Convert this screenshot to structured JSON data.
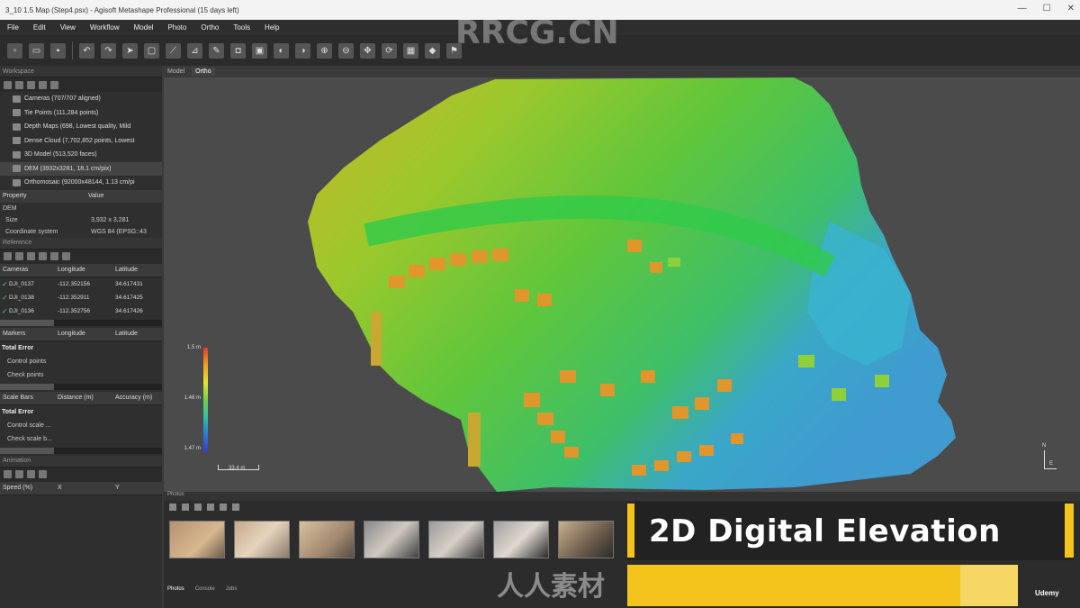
{
  "window": {
    "title": "3_10 1.5  Map (Step4.psx) - Agisoft Metashape Professional (15 days left)",
    "controls": [
      "—",
      "☐",
      "✕"
    ]
  },
  "menu": [
    "File",
    "Edit",
    "View",
    "Workflow",
    "Model",
    "Photo",
    "Ortho",
    "Tools",
    "Help"
  ],
  "workspace": {
    "header": "Workspace",
    "items": [
      "Cameras (707/707 aligned)",
      "Tie Points (111,284 points)",
      "Depth Maps (698, Lowest quality, Mild",
      "Dense Cloud (7,702,852 points, Lowest",
      "3D Model (513,520 faces)",
      "DEM (3932x3281, 18.1 cm/pix)",
      "Orthomosaic (92000x48144, 1.13 cm/pi"
    ]
  },
  "properties": {
    "columns": [
      "Property",
      "Value"
    ],
    "section": "DEM",
    "rows": [
      {
        "key": "Size",
        "value": "3,932 x 3,281"
      },
      {
        "key": "Coordinate system",
        "value": "WGS 84 (EPSG::43"
      }
    ]
  },
  "reference": {
    "header": "Reference",
    "camera_columns": [
      "Cameras",
      "Longitude",
      "Latitude"
    ],
    "cameras": [
      {
        "name": "DJI_0137",
        "lon": "-112.352156",
        "lat": "34.617431"
      },
      {
        "name": "DJI_0138",
        "lon": "-112.352911",
        "lat": "34.617425"
      },
      {
        "name": "DJI_0136",
        "lon": "-112.352756",
        "lat": "34.617426"
      }
    ],
    "marker_columns": [
      "Markers",
      "Longitude",
      "Latitude"
    ],
    "marker_rows": [
      "Total Error",
      "Control points",
      "Check points"
    ],
    "scalebar_columns": [
      "Scale Bars",
      "Distance (m)",
      "Accuracy (m)"
    ],
    "scalebar_rows": [
      "Total Error",
      "Control scale ...",
      "Check scale b..."
    ]
  },
  "animation": {
    "header": "Animation",
    "columns": [
      "Speed (%)",
      "X",
      "Y"
    ]
  },
  "view_tabs": [
    {
      "label": "Model",
      "active": false
    },
    {
      "label": "Ortho",
      "active": true
    }
  ],
  "legend": {
    "max": "1.5 m",
    "mid": "1.46 m",
    "min": "1.47 m"
  },
  "scale_label": "33.4 m",
  "north_label": "N",
  "east_label": "E",
  "photos": {
    "header": "Photos",
    "tabs": [
      "Photos",
      "Console",
      "Jobs"
    ]
  },
  "overlay": {
    "text": "2D Digital Elevation"
  },
  "watermarks": {
    "top": "RRCG.CN",
    "bottom": "人人素材",
    "udemy": "Udemy"
  },
  "colors": {
    "accent_yellow": "#f4c31c",
    "check_green": "#5fd35f"
  }
}
